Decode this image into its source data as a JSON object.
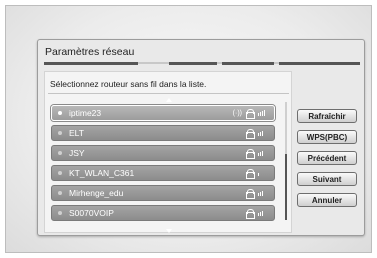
{
  "dialog": {
    "title": "Paramètres réseau",
    "instruction": "Sélectionnez routeur sans fil dans la liste."
  },
  "networks": [
    {
      "name": "iptime23",
      "selected": true,
      "icons": [
        "wps-icon",
        "lock-icon",
        "signal-icon"
      ],
      "signal": 4
    },
    {
      "name": "ELT",
      "selected": false,
      "icons": [
        "lock-icon",
        "signal-icon"
      ],
      "signal": 3
    },
    {
      "name": "JSY",
      "selected": false,
      "icons": [
        "lock-icon",
        "signal-icon"
      ],
      "signal": 3
    },
    {
      "name": "KT_WLAN_C361",
      "selected": false,
      "icons": [
        "lock-icon",
        "signal-icon"
      ],
      "signal": 1
    },
    {
      "name": "Mirhenge_edu",
      "selected": false,
      "icons": [
        "lock-icon",
        "signal-icon"
      ],
      "signal": 3
    },
    {
      "name": "S0070VOIP",
      "selected": false,
      "icons": [
        "lock-icon",
        "signal-icon"
      ],
      "signal": 3
    }
  ],
  "buttons": {
    "refresh": "Rafraîchir",
    "wps": "WPS(PBC)",
    "previous": "Précédent",
    "next": "Suivant",
    "cancel": "Annuler"
  },
  "colors": {
    "row": "#9a9a9a",
    "selected_row_border": "#ffffff",
    "panel": "#e9e9e9"
  }
}
